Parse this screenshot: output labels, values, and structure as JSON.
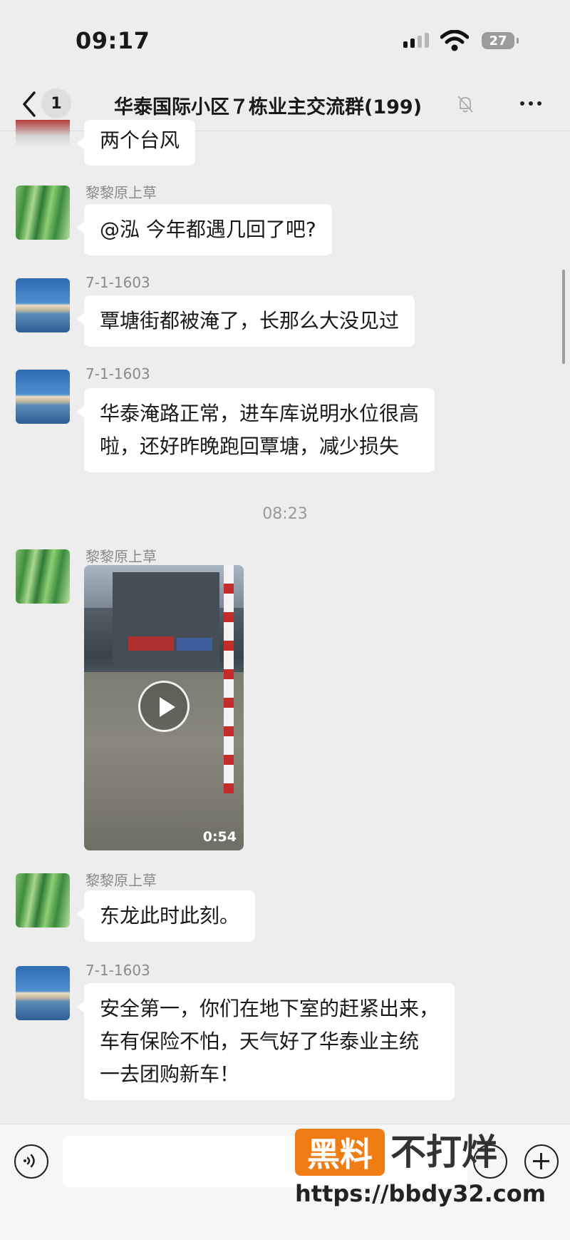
{
  "status_bar": {
    "time": "09:17",
    "battery": "27"
  },
  "nav": {
    "unread_count": "1",
    "title": "华泰国际小区７栋业主交流群(199)"
  },
  "messages": [
    {
      "text": "两个台风"
    },
    {
      "sender": "黎黎原上草",
      "text": "@泓 今年都遇几回了吧?"
    },
    {
      "sender": "7-1-1603",
      "text": "覃塘街都被淹了，长那么大没见过"
    },
    {
      "sender": "7-1-1603",
      "lines": [
        "华泰淹路正常，进车库说明水位很高",
        "啦，还好昨晚跑回覃塘，减少损失"
      ]
    },
    {
      "sender": "黎黎原上草",
      "video_duration": "0:54"
    },
    {
      "sender": "黎黎原上草",
      "text": "东龙此时此刻。"
    },
    {
      "sender": "7-1-1603",
      "lines": [
        "安全第一，你们在地下室的赶紧出来，",
        "车有保险不怕，天气好了华泰业主统",
        "一去团购新车！"
      ]
    }
  ],
  "time_divider": "08:23",
  "watermark": {
    "box_text": "黑料",
    "text": "不打烊",
    "url": "https://bbdy32.com"
  },
  "icons": {
    "back": "chevron-left-icon",
    "mute": "bell-off-icon",
    "more": "more-dots-icon",
    "voice": "voice-icon",
    "emoji": "emoji-icon",
    "plus": "plus-icon",
    "play": "play-icon"
  },
  "colors": {
    "background": "#ededed",
    "bubble": "#ffffff",
    "watermark_accent": "#f07d14"
  }
}
